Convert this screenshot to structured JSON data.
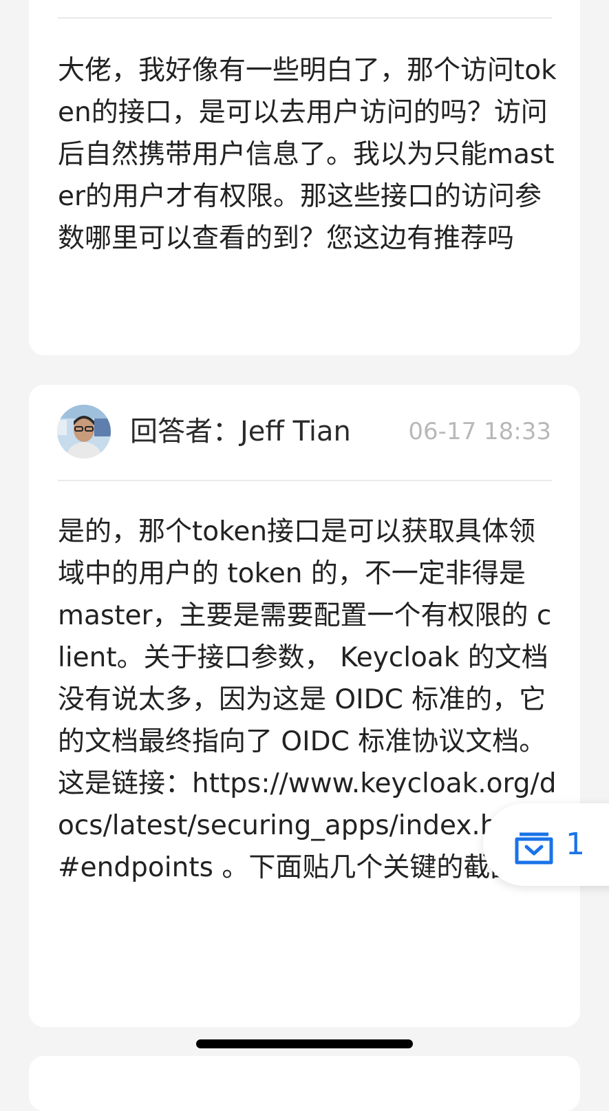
{
  "question": {
    "text": "大佬，我好像有一些明白了，那个访问token的接口，是可以去用户访问的吗？访问后自然携带用户信息了。我以为只能master的用户才有权限。那这些接口的访问参数哪里可以查看的到？您这边有推荐吗"
  },
  "answer": {
    "answerer_label": "回答者：",
    "answerer_name": "Jeff Tian",
    "time": "06-17 18:33",
    "avatar_icon": "user-avatar-photo",
    "text": "是的，那个token接口是可以获取具体领域中的用户的 token 的，不一定非得是 master，主要是需要配置一个有权限的 client。关于接口参数， Keycloak 的文档没有说太多，因为这是 OIDC 标准的，它的文档最终指向了 OIDC 标准协议文档。这是链接：https://www.keycloak.org/docs/latest/securing_apps/index.html#endpoints 。下面贴几个关键的截图："
  },
  "floating_badge": {
    "icon": "inbox-download-icon",
    "count": "1",
    "color": "#1a73e8"
  }
}
